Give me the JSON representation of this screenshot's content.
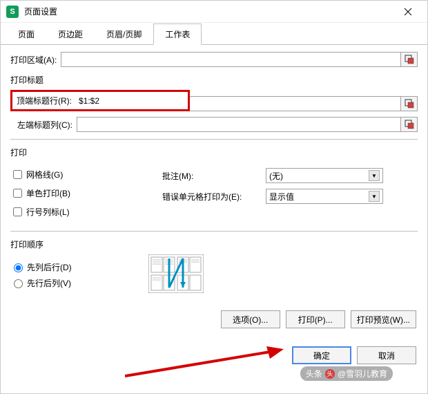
{
  "window": {
    "title": "页面设置",
    "app_initial": "S"
  },
  "tabs": {
    "page": "页面",
    "margin": "页边距",
    "header_footer": "页眉/页脚",
    "sheet": "工作表"
  },
  "print_area": {
    "label": "打印区域(A):",
    "value": ""
  },
  "print_titles": {
    "section": "打印标题",
    "top_row_label": "顶端标题行(R):",
    "top_row_value": "$1:$2",
    "left_col_label": "左端标题列(C):",
    "left_col_value": ""
  },
  "print_section": {
    "section": "打印",
    "gridlines": "网格线(G)",
    "black_white": "单色打印(B)",
    "row_col_headings": "行号列标(L)",
    "comments_label": "批注(M):",
    "comments_value": "(无)",
    "errors_label": "错误单元格打印为(E):",
    "errors_value": "显示值"
  },
  "page_order": {
    "section": "打印顺序",
    "down_then_over": "先列后行(D)",
    "over_then_down": "先行后列(V)"
  },
  "buttons": {
    "options": "选项(O)...",
    "print": "打印(P)...",
    "preview": "打印预览(W)...",
    "ok": "确定",
    "cancel": "取消"
  },
  "watermark": {
    "prefix": "头条",
    "text": "@雪羽儿教育"
  }
}
